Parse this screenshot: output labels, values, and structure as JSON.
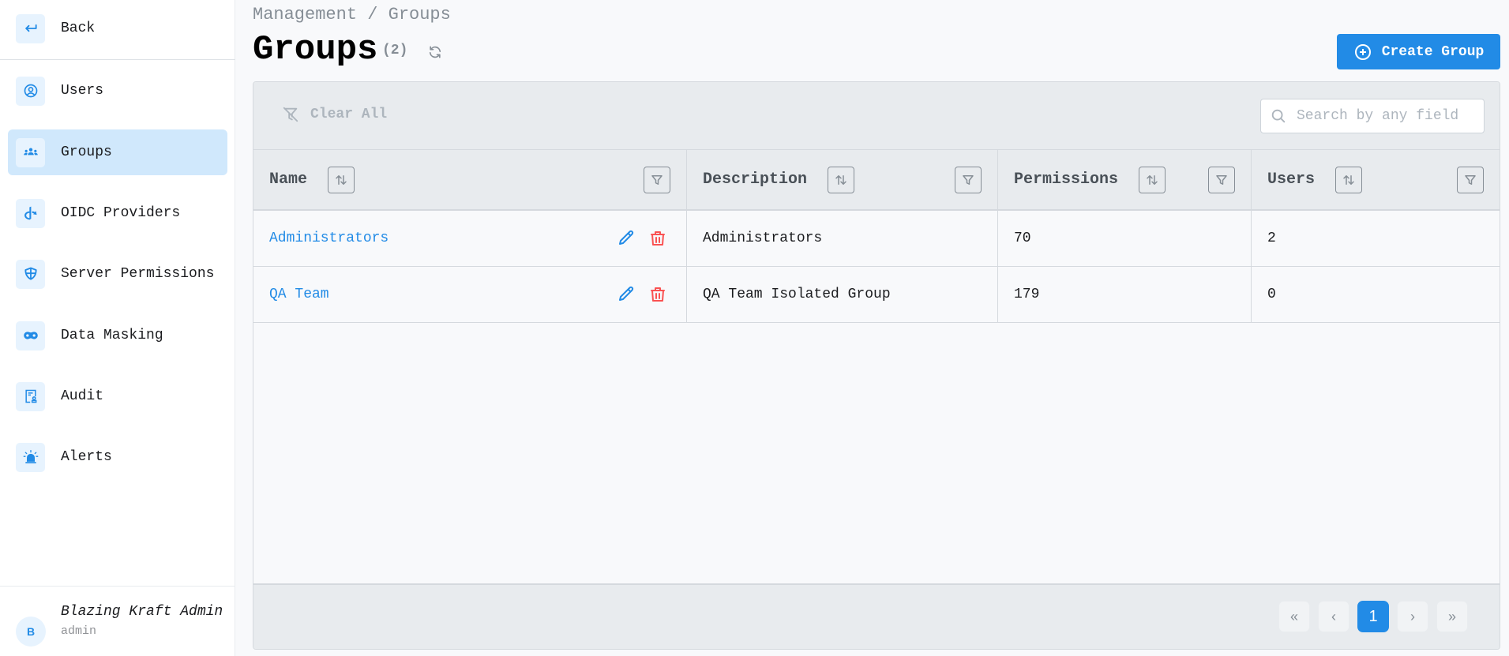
{
  "sidebar": {
    "back_label": "Back",
    "items": [
      {
        "label": "Users",
        "icon": "user-circle-icon",
        "active": false
      },
      {
        "label": "Groups",
        "icon": "users-group-icon",
        "active": true
      },
      {
        "label": "OIDC Providers",
        "icon": "openid-icon",
        "active": false
      },
      {
        "label": "Server Permissions",
        "icon": "shield-icon",
        "active": false
      },
      {
        "label": "Data Masking",
        "icon": "mask-icon",
        "active": false
      },
      {
        "label": "Audit",
        "icon": "audit-icon",
        "active": false
      },
      {
        "label": "Alerts",
        "icon": "alarm-light-icon",
        "active": false
      }
    ],
    "user": {
      "avatar_initial": "B",
      "name": "Blazing Kraft Admin",
      "role": "admin"
    }
  },
  "header": {
    "breadcrumb": "Management / Groups",
    "title": "Groups",
    "count": "(2)",
    "create_label": "Create Group"
  },
  "toolbar": {
    "clear_all_label": "Clear All",
    "search_placeholder": "Search by any field",
    "search_value": ""
  },
  "table": {
    "columns": [
      {
        "label": "Name"
      },
      {
        "label": "Description"
      },
      {
        "label": "Permissions"
      },
      {
        "label": "Users"
      }
    ],
    "rows": [
      {
        "name": "Administrators",
        "description": "Administrators",
        "permissions": "70",
        "users": "2"
      },
      {
        "name": "QA Team",
        "description": "QA Team Isolated Group",
        "permissions": "179",
        "users": "0"
      }
    ]
  },
  "pagination": {
    "first": "«",
    "prev": "‹",
    "current_page": "1",
    "next": "›",
    "last": "»"
  },
  "colors": {
    "accent": "#228be6",
    "danger": "#fa5252",
    "active_nav_bg": "#d0e8fc"
  }
}
